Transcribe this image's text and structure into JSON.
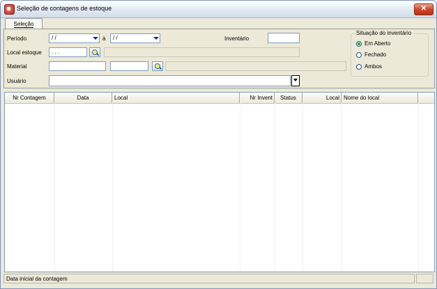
{
  "window": {
    "title": "Seleção de contagens de estoque",
    "close_glyph": "✕"
  },
  "tabs": [
    {
      "label": "Seleção"
    }
  ],
  "form": {
    "periodo_label": "Período",
    "periodo_from": "/ /",
    "periodo_sep": "à",
    "periodo_to": "/ /",
    "inventario_label": "Inventário",
    "inventario_value": "",
    "local_estoque_label": "Local estoque",
    "local_estoque_value": ". . .",
    "material_label": "Material",
    "material_code": "",
    "material_sub": "",
    "usuario_label": "Usuário",
    "usuario_value": ""
  },
  "situacao": {
    "title": "Situação do inventário",
    "options": [
      "Em Aberto",
      "Fechado",
      "Ambos"
    ],
    "selected": "Em Aberto"
  },
  "grid": {
    "columns": [
      "Nr Contagem",
      "Data",
      "Local",
      "Nr Invent",
      "Status",
      "Local",
      "Nome do local"
    ],
    "rows": []
  },
  "statusbar": {
    "text": "Data inicial da contagem"
  },
  "icons": {
    "app": "app-icon",
    "lookup": "search-lookup-icon",
    "dropdown": "chevron-down-icon"
  }
}
